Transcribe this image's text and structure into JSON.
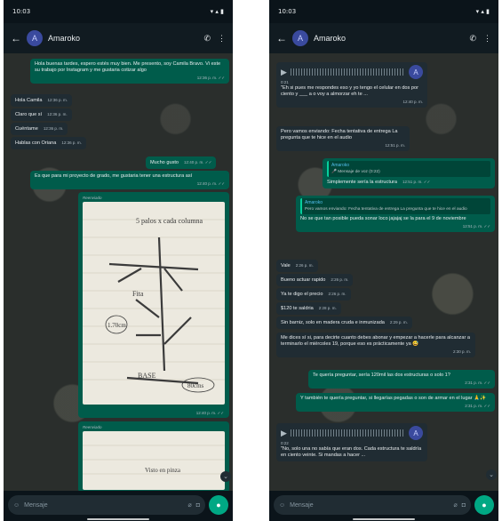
{
  "common": {
    "status_time": "10:03",
    "contact_name": "Amaroko",
    "avatar_letter": "A",
    "input_placeholder": "Mensaje"
  },
  "left": {
    "messages": {
      "m1": {
        "text": "Hola buenas tardes, espero estés muy bien. Me presento, soy Camila Bravo. Vi este su trabajo por Instagram y me gustaria cotizar algo",
        "time": "12:36 p. m. ✓✓"
      },
      "m2": {
        "text": "Hola Camila",
        "time": "12:36 p. m."
      },
      "m3": {
        "text": "Claro que sí",
        "time": "12:36 p. m."
      },
      "m4": {
        "text": "Cuéntame",
        "time": "12:36 p. m."
      },
      "m5": {
        "text": "Hablas con Oriana",
        "time": "12:36 p. m."
      },
      "m6": {
        "text": "Mucho gusto",
        "time": "12:40 p. m. ✓✓"
      },
      "m7": {
        "text": "Es que para mi proyecto de grado, me gustaria tener una estructura así",
        "time": "12:40 p. m. ✓✓"
      },
      "m8": {
        "forwarded": "Reenviado",
        "time": "12:40 p. m. ✓✓"
      },
      "m9": {
        "forwarded": "Reenviado"
      }
    },
    "sketch": {
      "label_top": "5 palos x cada columna",
      "label_fit": "Fita",
      "label_number": "1.70cm",
      "label_base": "BASE",
      "label_80": "80cms",
      "label_2": "Visto en pinza"
    }
  },
  "right": {
    "messages": {
      "r1": {
        "duration": "0:21",
        "text": "\"Eh si pues me respondes eso y yo tengo el celular en dos por ciento y ___ a o voy a almorzar eh te ...",
        "time": "12:40 p. m."
      },
      "r2": {
        "text": "Pero vamos enviando: Fecha tentativa de entrega La pregunta que te hice en el audio",
        "time": "12:51 p. m."
      },
      "r3": {
        "quote_name": "Amaroko",
        "quote_text": "🎤 Mensaje de voz (0:22)",
        "text": "Simplemente sería la estructura",
        "time": "12:51 p. m. ✓✓"
      },
      "r4": {
        "quote_name": "Amaroko",
        "quote_text": "Pero vamos enviando: Fecha tentativa de entrega La pregunta que te hice en el audio",
        "text": "No se que tan posible pueda sonar loco jajajaj se la para el 9 de noviembre",
        "time": "12:51 p. m. ✓✓"
      },
      "r5": {
        "text": "Vale",
        "time": "2:26 p. m."
      },
      "r6": {
        "text": "Bueno actuar rapido",
        "time": "2:26 p. m."
      },
      "r7": {
        "text": "Ya te digo el precio",
        "time": "2:26 p. m."
      },
      "r8": {
        "text": "$120 te saldria",
        "time": "2:28 p. m."
      },
      "r9": {
        "text": "Sin barniz, solo en madera cruda e inmunizada",
        "time": "2:29 p. m."
      },
      "r10": {
        "text": "Me dices sí si, para decirte cuanto debes abonar y empezar a hacerle para alcanzar a terminarlo el miércoles 19, porque eso es prácticamente ya 😅",
        "time": "2:30 p. m."
      },
      "r11": {
        "text": "Te quería preguntar, sería 120mil las dos estructuras o solo 1?",
        "time": "2:31 p. m. ✓✓"
      },
      "r12": {
        "text": "Y también te quería preguntar, si llegarías pegadas o son de armar en el lugar 🙏✨",
        "time": "2:31 p. m. ✓✓"
      },
      "r13": {
        "duration": "0:22",
        "text": "\"No, solo una no sabía que eran dos. Cada estructura te saldría en ciento veinte. Si mandas a hacer ..."
      }
    }
  }
}
